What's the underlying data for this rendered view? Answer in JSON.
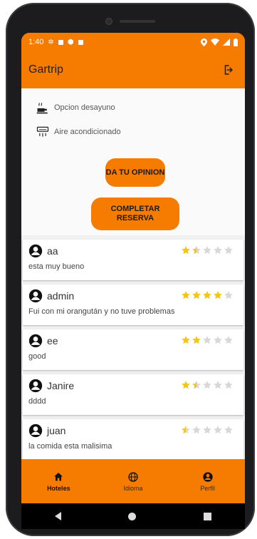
{
  "status_bar": {
    "time": "1:40"
  },
  "app_bar": {
    "title": "Gartrip"
  },
  "amenities": [
    {
      "label": "Opcion desayuno",
      "icon": "breakfast-icon"
    },
    {
      "label": "Aire acondicionado",
      "icon": "air-conditioner-icon"
    }
  ],
  "buttons": {
    "opinion_label": "DA TU OPINION",
    "reserva_label": "COMPLETAR RESERVA"
  },
  "reviews": [
    {
      "user": "aa",
      "comment": "esta muy bueno",
      "rating": 1.5
    },
    {
      "user": "admin",
      "comment": "Fui con mi orangután y no tuve problemas",
      "rating": 4
    },
    {
      "user": "ee",
      "comment": "good",
      "rating": 2
    },
    {
      "user": "Janire",
      "comment": "dddd",
      "rating": 1.5
    },
    {
      "user": "juan",
      "comment": "la comida esta malisima",
      "rating": 0.5
    }
  ],
  "bottom_nav": [
    {
      "label": "Hoteles",
      "icon": "home-icon",
      "active": true
    },
    {
      "label": "Idioma",
      "icon": "globe-icon",
      "active": false
    },
    {
      "label": "Perfil",
      "icon": "profile-icon",
      "active": false
    }
  ],
  "colors": {
    "accent": "#f57c00",
    "star": "#f5c518",
    "star_empty": "#d8d8d8"
  }
}
